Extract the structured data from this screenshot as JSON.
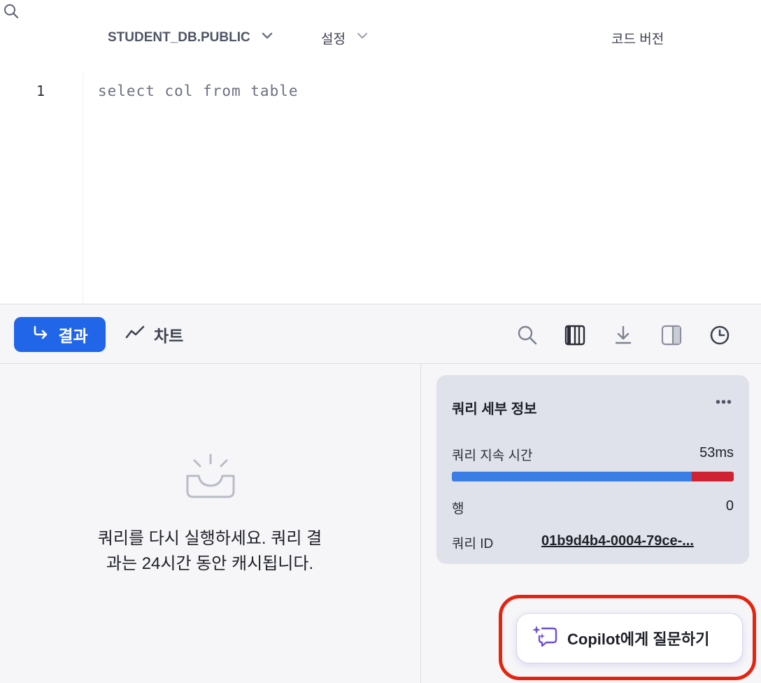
{
  "topbar": {
    "database": "STUDENT_DB.PUBLIC",
    "settings": "설정",
    "code_version": "코드 버전",
    "icons": {
      "db_chevron": "chevron-down-icon",
      "settings_chevron": "chevron-down-icon",
      "search": "search-icon"
    }
  },
  "editor": {
    "line_number": "1",
    "code": "select col from table"
  },
  "results_toolbar": {
    "results_tab": "결과",
    "chart_tab": "차트",
    "accent_color": "#2165e8",
    "icons": [
      "return-arrow-icon",
      "line-chart-icon",
      "search-icon",
      "columns-icon",
      "download-icon",
      "side-panel-icon",
      "history-clock-icon"
    ]
  },
  "results": {
    "empty_message_line1": "쿼리를 다시 실행하세요. 쿼리 결",
    "empty_message_line2": "과는 24시간 동안 캐시됩니다.",
    "empty_icon": "empty-inbox-icon"
  },
  "query_details": {
    "title": "쿼리 세부 정보",
    "more": "•••",
    "duration_label": "쿼리 지속 시간",
    "duration_value": "53ms",
    "duration_bar": {
      "blue_fraction": 0.85,
      "red_fraction": 0.15,
      "blue_color": "#3a7de4",
      "red_color": "#cf2232"
    },
    "rows_label": "행",
    "rows_value": "0",
    "query_id_label": "쿼리 ID",
    "query_id_value": "01b9d4b4-0004-79ce-..."
  },
  "copilot": {
    "label": "Copilot에게 질문하기",
    "icon": "sparkle-chat-icon",
    "highlight_color": "#e52410"
  }
}
